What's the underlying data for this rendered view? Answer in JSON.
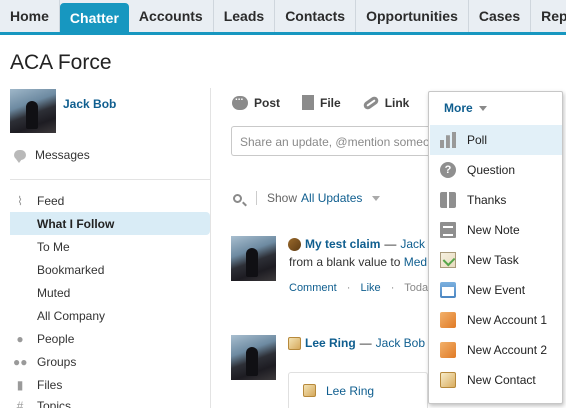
{
  "tabs": [
    "Home",
    "Chatter",
    "Accounts",
    "Leads",
    "Contacts",
    "Opportunities",
    "Cases",
    "Reports"
  ],
  "active_tab": "Chatter",
  "page_title": "ACA Force",
  "profile": {
    "name": "Jack Bob"
  },
  "messages_label": "Messages",
  "nav": {
    "feed": "Feed",
    "what_i_follow": "What I Follow",
    "to_me": "To Me",
    "bookmarked": "Bookmarked",
    "muted": "Muted",
    "all_company": "All Company",
    "people": "People",
    "groups": "Groups",
    "files": "Files",
    "topics": "Topics"
  },
  "publisher": {
    "post": "Post",
    "file": "File",
    "link": "Link",
    "share_placeholder": "Share an update, @mention someo"
  },
  "filter": {
    "show_label": "Show",
    "show_value": "All Updates"
  },
  "feed": {
    "item1": {
      "title": "My test claim",
      "dash": "—",
      "author": "Jack",
      "line2_text": "from a blank value to",
      "line2_link": "Med",
      "comment": "Comment",
      "like": "Like",
      "dot": "·",
      "time": "Today"
    },
    "item2": {
      "title": "Lee Ring",
      "dash": "—",
      "author": "Jack Bob",
      "card_name": "Lee Ring"
    }
  },
  "more_menu": {
    "label": "More",
    "items": [
      "Poll",
      "Question",
      "Thanks",
      "New Note",
      "New Task",
      "New Event",
      "New Account 1",
      "New Account 2",
      "New Contact"
    ]
  },
  "icons": {
    "messages": "speech-bubble-icon",
    "feed": "pulse-icon",
    "people": "person-icon",
    "groups": "group-icon",
    "files": "document-icon",
    "search": "search-icon",
    "post": "chat-bubble-icon",
    "file": "file-icon",
    "link": "link-icon"
  },
  "colors": {
    "accent": "#1797c0",
    "link": "#0f5e8f",
    "selected_nav": "#d9ecf6",
    "menu_highlight": "#e2f0f8"
  }
}
